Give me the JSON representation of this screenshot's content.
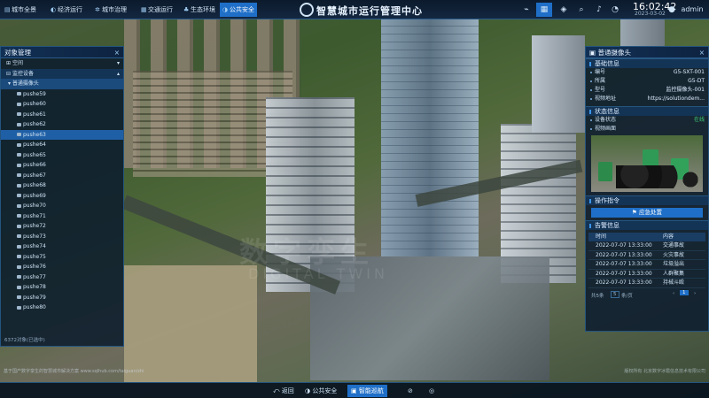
{
  "header": {
    "tabs": [
      {
        "icon": "▤",
        "label": "城市全景"
      },
      {
        "icon": "◐",
        "label": "经济运行"
      },
      {
        "icon": "✲",
        "label": "城市治理"
      },
      {
        "icon": "▦",
        "label": "交通运行"
      },
      {
        "icon": "♣",
        "label": "生态环境"
      },
      {
        "icon": "◑",
        "label": "公共安全"
      }
    ],
    "title": "智慧城市运行管理中心",
    "time": "16:02:42",
    "date": "2023-03-02",
    "user": "admin"
  },
  "left_panel": {
    "title": "对象管理",
    "tree": [
      {
        "label": "空间",
        "level": 0
      },
      {
        "label": "监控设备",
        "level": 0
      },
      {
        "label": "普通摄像头",
        "level": 1
      }
    ],
    "items": [
      "pushe59",
      "pushe60",
      "pushe61",
      "pushe62",
      "pushe63",
      "pushe64",
      "pushe65",
      "pushe66",
      "pushe67",
      "pushe68",
      "pushe69",
      "pushe70",
      "pushe71",
      "pushe72",
      "pushe73",
      "pushe74",
      "pushe75",
      "pushe76",
      "pushe77",
      "pushe78",
      "pushe79",
      "pushe80"
    ],
    "selected": "pushe63",
    "footer": "6372对象(已选中)"
  },
  "right_panel": {
    "title": "普通摄像头",
    "basic": {
      "title": "基础信息",
      "rows": [
        {
          "k": "编号",
          "v": "G5-SXT-001"
        },
        {
          "k": "所属",
          "v": "G5-DT"
        },
        {
          "k": "型号",
          "v": "监控摄像头-001"
        },
        {
          "k": "视频地址",
          "v": "https://solutiondem..."
        }
      ]
    },
    "status": {
      "title": "状态信息",
      "device_label": "设备状态",
      "device_value": "在线",
      "video_label": "视频画面"
    },
    "ops": {
      "title": "操作指令",
      "button": "应急处置"
    },
    "alerts": {
      "title": "告警信息",
      "cols": [
        "时间",
        "内容"
      ],
      "rows": [
        [
          "2022-07-07 13:33:00",
          "交通事故"
        ],
        [
          "2022-07-07 13:33:00",
          "火灾事故"
        ],
        [
          "2022-07-07 13:33:00",
          "垃圾溢出"
        ],
        [
          "2022-07-07 13:33:00",
          "人群聚集"
        ],
        [
          "2022-07-07 13:33:00",
          "持械斗殴"
        ]
      ],
      "pager": {
        "total": "共5条",
        "size": "5",
        "per": "条/页",
        "current": "1"
      }
    }
  },
  "bottom": {
    "items": [
      {
        "label": "返回",
        "icon": "⤺"
      },
      {
        "label": "公共安全",
        "icon": "◑"
      },
      {
        "label": "智能巡航",
        "icon": "▣"
      }
    ]
  },
  "watermark": {
    "main": "数字孪生",
    "sub": "DIGITAL TWIN"
  },
  "footer": {
    "left": "基于国产数字孪生的智慧城市解决方案 www.sqlhub.com/taiguan/zhi",
    "right": "版权所有 北京数字冰雹信息技术有限公司"
  }
}
